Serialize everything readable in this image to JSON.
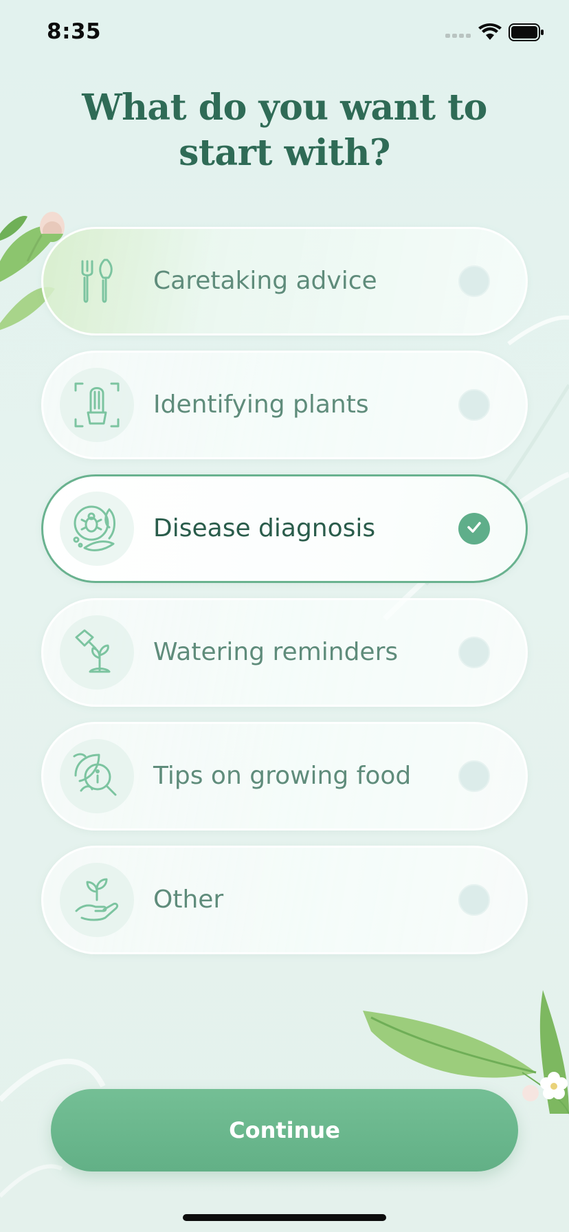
{
  "status_bar": {
    "time": "8:35"
  },
  "title": {
    "line1": "What do you want to",
    "line2": "start with?"
  },
  "options": [
    {
      "label": "Caretaking advice",
      "icon": "garden-tools-icon",
      "selected": false
    },
    {
      "label": "Identifying plants",
      "icon": "cactus-scan-icon",
      "selected": false
    },
    {
      "label": "Disease diagnosis",
      "icon": "bug-plant-icon",
      "selected": true
    },
    {
      "label": "Watering reminders",
      "icon": "watering-can-icon",
      "selected": false
    },
    {
      "label": "Tips on growing food",
      "icon": "leaf-info-search-icon",
      "selected": false
    },
    {
      "label": "Other",
      "icon": "hand-plant-icon",
      "selected": false
    }
  ],
  "continue_label": "Continue",
  "colors": {
    "accent": "#5fae8a",
    "title": "#2f6b56",
    "label": "#5f8c7b",
    "label_selected": "#2a5c4b",
    "icon_line": "#7cc4a0"
  }
}
